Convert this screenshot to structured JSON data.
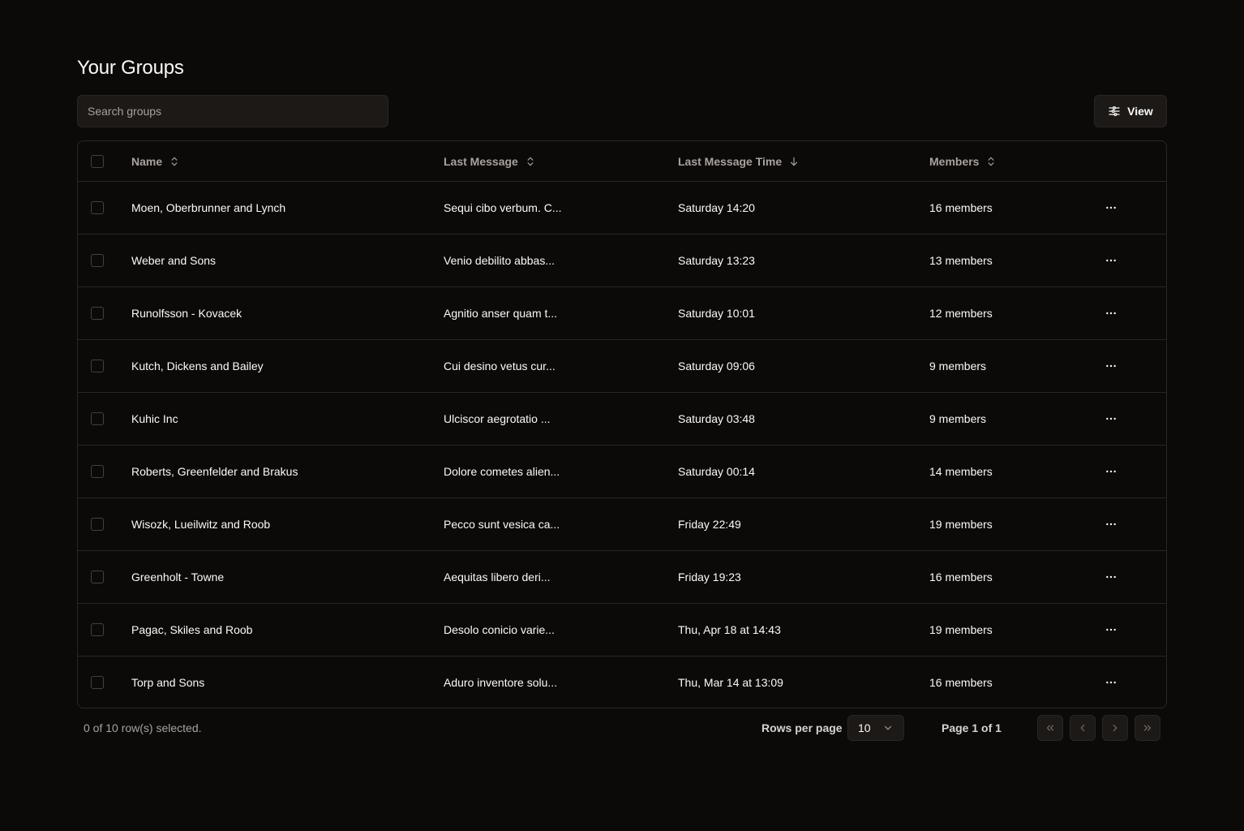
{
  "header": {
    "title": "Your Groups"
  },
  "search": {
    "placeholder": "Search groups",
    "value": ""
  },
  "toolbar": {
    "view_label": "View"
  },
  "table": {
    "columns": [
      {
        "label": "Name",
        "sort": "unsorted"
      },
      {
        "label": "Last Message",
        "sort": "unsorted"
      },
      {
        "label": "Last Message Time",
        "sort": "descending"
      },
      {
        "label": "Members",
        "sort": "unsorted"
      }
    ],
    "rows": [
      {
        "name": "Moen, Oberbrunner and Lynch",
        "last_message": "Sequi cibo verbum. C...",
        "time": "Saturday 14:20",
        "members": "16 members"
      },
      {
        "name": "Weber and Sons",
        "last_message": "Venio debilito abbas...",
        "time": "Saturday 13:23",
        "members": "13 members"
      },
      {
        "name": "Runolfsson - Kovacek",
        "last_message": "Agnitio anser quam t...",
        "time": "Saturday 10:01",
        "members": "12 members"
      },
      {
        "name": "Kutch, Dickens and Bailey",
        "last_message": "Cui desino vetus cur...",
        "time": "Saturday 09:06",
        "members": "9 members"
      },
      {
        "name": "Kuhic Inc",
        "last_message": "Ulciscor aegrotatio ...",
        "time": "Saturday 03:48",
        "members": "9 members"
      },
      {
        "name": "Roberts, Greenfelder and Brakus",
        "last_message": "Dolore cometes alien...",
        "time": "Saturday 00:14",
        "members": "14 members"
      },
      {
        "name": "Wisozk, Lueilwitz and Roob",
        "last_message": "Pecco sunt vesica ca...",
        "time": "Friday 22:49",
        "members": "19 members"
      },
      {
        "name": "Greenholt - Towne",
        "last_message": "Aequitas libero deri...",
        "time": "Friday 19:23",
        "members": "16 members"
      },
      {
        "name": "Pagac, Skiles and Roob",
        "last_message": "Desolo conicio varie...",
        "time": "Thu, Apr 18 at 14:43",
        "members": "19 members"
      },
      {
        "name": "Torp and Sons",
        "last_message": "Aduro inventore solu...",
        "time": "Thu, Mar 14 at 13:09",
        "members": "16 members"
      }
    ]
  },
  "footer": {
    "selected_text": "0 of 10 row(s) selected.",
    "rows_per_page_label": "Rows per page",
    "rows_per_page_value": "10",
    "page_text": "Page 1 of 1"
  },
  "icons": {
    "view": "sliders-icon",
    "sort_unsorted": "chevrons-up-down-icon",
    "sort_desc": "arrow-down-icon",
    "row_actions": "more-horizontal-icon",
    "dropdown": "chevron-down-icon",
    "first_page": "chevrons-left-icon",
    "prev_page": "chevron-left-icon",
    "next_page": "chevron-right-icon",
    "last_page": "chevrons-right-icon"
  },
  "colors": {
    "background": "#0c0a09",
    "border": "#292524",
    "text": "#fafaf9",
    "muted_text": "#a8a29e"
  }
}
